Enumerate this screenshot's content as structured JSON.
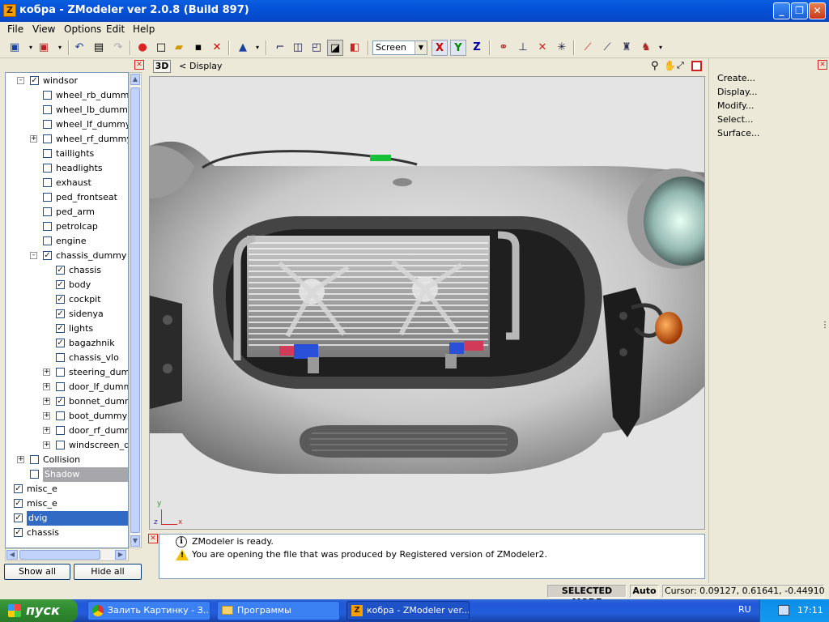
{
  "window": {
    "title": "кобра - ZModeler ver 2.0.8 (Build 897)",
    "app_icon": "Z"
  },
  "menu": [
    "File",
    "View",
    "Options",
    "Edit",
    "Help"
  ],
  "toolbar": {
    "view_mode": "Screen",
    "axes": [
      "X",
      "Y",
      "Z"
    ]
  },
  "viewport": {
    "tab_3d": "3D",
    "title": "Display",
    "axis_y": "y",
    "axis_z": "z",
    "axis_x": "x"
  },
  "tree": [
    {
      "label": "windsor",
      "level": 0,
      "checked": true,
      "expander": "-"
    },
    {
      "label": "wheel_rb_dummy",
      "level": 1,
      "checked": false,
      "expander": ""
    },
    {
      "label": "wheel_lb_dummy",
      "level": 1,
      "checked": false,
      "expander": ""
    },
    {
      "label": "wheel_lf_dummy",
      "level": 1,
      "checked": false,
      "expander": ""
    },
    {
      "label": "wheel_rf_dummy",
      "level": 1,
      "checked": false,
      "expander": "+"
    },
    {
      "label": "taillights",
      "level": 1,
      "checked": false,
      "expander": ""
    },
    {
      "label": "headlights",
      "level": 1,
      "checked": false,
      "expander": ""
    },
    {
      "label": "exhaust",
      "level": 1,
      "checked": false,
      "expander": ""
    },
    {
      "label": "ped_frontseat",
      "level": 1,
      "checked": false,
      "expander": ""
    },
    {
      "label": "ped_arm",
      "level": 1,
      "checked": false,
      "expander": ""
    },
    {
      "label": "petrolcap",
      "level": 1,
      "checked": false,
      "expander": ""
    },
    {
      "label": "engine",
      "level": 1,
      "checked": false,
      "expander": ""
    },
    {
      "label": "chassis_dummy",
      "level": 1,
      "checked": true,
      "expander": "-"
    },
    {
      "label": "chassis",
      "level": 2,
      "checked": true,
      "expander": ""
    },
    {
      "label": "body",
      "level": 2,
      "checked": true,
      "expander": ""
    },
    {
      "label": "cockpit",
      "level": 2,
      "checked": true,
      "expander": ""
    },
    {
      "label": "sidenya",
      "level": 2,
      "checked": true,
      "expander": ""
    },
    {
      "label": "lights",
      "level": 2,
      "checked": true,
      "expander": ""
    },
    {
      "label": "bagazhnik",
      "level": 2,
      "checked": true,
      "expander": ""
    },
    {
      "label": "chassis_vlo",
      "level": 2,
      "checked": false,
      "expander": ""
    },
    {
      "label": "steering_dumm",
      "level": 2,
      "checked": false,
      "expander": "+"
    },
    {
      "label": "door_lf_dummy",
      "level": 2,
      "checked": false,
      "expander": "+"
    },
    {
      "label": "bonnet_dummy",
      "level": 2,
      "checked": true,
      "expander": "+"
    },
    {
      "label": "boot_dummy",
      "level": 2,
      "checked": false,
      "expander": "+"
    },
    {
      "label": "door_rf_dummy",
      "level": 2,
      "checked": false,
      "expander": "+"
    },
    {
      "label": "windscreen_du",
      "level": 2,
      "checked": false,
      "expander": "+"
    },
    {
      "label": "Collision",
      "level": 0,
      "checked": false,
      "expander": "+"
    },
    {
      "label": "Shadow",
      "level": 0,
      "checked": false,
      "expander": "",
      "state": "gray"
    },
    {
      "label": "misc_e",
      "level": -1,
      "checked": true,
      "expander": ""
    },
    {
      "label": "misc_e",
      "level": -1,
      "checked": true,
      "expander": ""
    },
    {
      "label": "dvig",
      "level": -1,
      "checked": true,
      "expander": "",
      "state": "sel"
    },
    {
      "label": "chassis",
      "level": -1,
      "checked": true,
      "expander": ""
    }
  ],
  "buttons": {
    "show_all": "Show all",
    "hide_all": "Hide all"
  },
  "right_panel": [
    "Create...",
    "Display...",
    "Modify...",
    "Select...",
    "Surface..."
  ],
  "log": [
    {
      "icon": "info-icon",
      "text": "ZModeler is ready."
    },
    {
      "icon": "warning-icon",
      "text": "You are opening the file that was produced by Registered version of ZModeler2."
    }
  ],
  "status": {
    "mode": "SELECTED MODE",
    "auto": "Auto",
    "cursor": "Cursor: 0.09127, 0.61641, -0.44910"
  },
  "taskbar": {
    "start": "пуск",
    "tasks": [
      {
        "label": "Залить Картинку - З...",
        "icon": "chrome-icon"
      },
      {
        "label": "Программы",
        "icon": "folder-icon"
      },
      {
        "label": "кобра - ZModeler ver...",
        "icon": "zmodeler-icon",
        "active": true
      }
    ],
    "lang": "RU",
    "clock": "17:11"
  }
}
